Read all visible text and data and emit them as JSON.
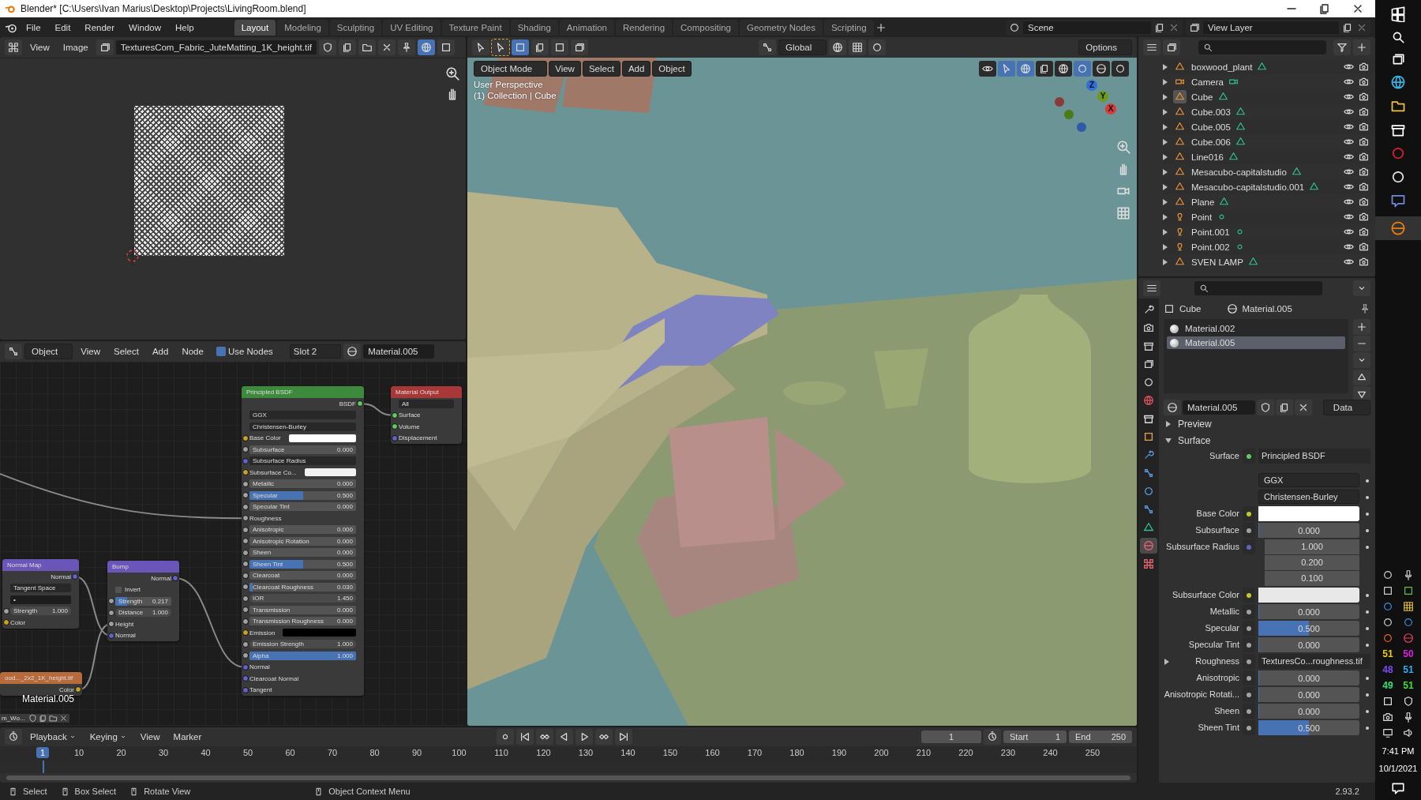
{
  "window": {
    "title": "Blender* [C:\\Users\\Ivan Marius\\Desktop\\Projects\\LivingRoom.blend]"
  },
  "menu": [
    "File",
    "Edit",
    "Render",
    "Window",
    "Help"
  ],
  "workspaces": [
    {
      "label": "Layout",
      "selected": true
    },
    {
      "label": "Modeling",
      "selected": false
    },
    {
      "label": "Sculpting",
      "selected": false
    },
    {
      "label": "UV Editing",
      "selected": false
    },
    {
      "label": "Texture Paint",
      "selected": false
    },
    {
      "label": "Shading",
      "selected": false
    },
    {
      "label": "Animation",
      "selected": false
    },
    {
      "label": "Rendering",
      "selected": false
    },
    {
      "label": "Compositing",
      "selected": false
    },
    {
      "label": "Geometry Nodes",
      "selected": false
    },
    {
      "label": "Scripting",
      "selected": false
    }
  ],
  "scene": "Scene",
  "view_layer": "View Layer",
  "image_editor": {
    "menus": [
      "View",
      "Image"
    ],
    "image": "TexturesCom_Fabric_JuteMatting_1K_height.tif"
  },
  "viewport": {
    "orientation": "Global",
    "options": "Options",
    "mode": "Object Mode",
    "menus": [
      "View",
      "Select",
      "Add",
      "Object"
    ],
    "overlay": [
      "User Perspective",
      "(1) Collection | Cube"
    ],
    "gizmo": [
      {
        "label": "Z",
        "color": "#2f6fd8"
      },
      {
        "label": "Y",
        "color": "#6a9a1e"
      },
      {
        "label": "X",
        "color": "#d83a3a"
      }
    ]
  },
  "node_editor": {
    "object": "Object",
    "menus": [
      "View",
      "Select",
      "Add",
      "Node"
    ],
    "use_nodes": {
      "label": "Use Nodes",
      "checked": true
    },
    "slot": "Slot 2",
    "material": "Material.005",
    "material_label": "Material.005",
    "image_footer": "m_Wo...",
    "nodes": [
      {
        "title": "Principled BSDF",
        "kind": "shader",
        "rows": [
          {
            "kind": "output",
            "label": "BSDF",
            "socket": {
              "color": "#63c763"
            }
          },
          {
            "kind": "dropdown",
            "value": "GGX"
          },
          {
            "kind": "dropdown",
            "value": "Christensen-Burley"
          },
          {
            "kind": "color",
            "label": "Base Color",
            "socket": {
              "color": "#c7a229"
            },
            "color": "#ffffff"
          },
          {
            "kind": "slider",
            "label": "Subsurface",
            "value": "0.000",
            "level": 0,
            "socket": {
              "color": "#a1a1a1"
            }
          },
          {
            "kind": "dropdown",
            "value": "Subsurface Radius",
            "socket": {
              "color": "#6363c7"
            }
          },
          {
            "kind": "color",
            "label": "Subsurface Co...",
            "socket": {
              "color": "#c7a229"
            },
            "color": "#f2f2f2"
          },
          {
            "kind": "slider",
            "label": "Metallic",
            "value": "0.000",
            "level": 0,
            "socket": {
              "color": "#a1a1a1"
            }
          },
          {
            "kind": "slider",
            "label": "Specular",
            "value": "0.500",
            "level": 0.5,
            "socket": {
              "color": "#a1a1a1"
            }
          },
          {
            "kind": "slider",
            "label": "Specular Tint",
            "value": "0.000",
            "level": 0,
            "socket": {
              "color": "#a1a1a1"
            }
          },
          {
            "kind": "input",
            "label": "Roughness",
            "socket": {
              "color": "#a1a1a1"
            }
          },
          {
            "kind": "slider",
            "label": "Anisotropic",
            "value": "0.000",
            "level": 0,
            "socket": {
              "color": "#a1a1a1"
            }
          },
          {
            "kind": "slider",
            "label": "Anisotropic Rotation",
            "value": "0.000",
            "level": 0,
            "socket": {
              "color": "#a1a1a1"
            }
          },
          {
            "kind": "slider",
            "label": "Sheen",
            "value": "0.000",
            "level": 0,
            "socket": {
              "color": "#a1a1a1"
            }
          },
          {
            "kind": "slider",
            "label": "Sheen Tint",
            "value": "0.500",
            "level": 0.5,
            "socket": {
              "color": "#a1a1a1"
            }
          },
          {
            "kind": "slider",
            "label": "Clearcoat",
            "value": "0.000",
            "level": 0,
            "socket": {
              "color": "#a1a1a1"
            }
          },
          {
            "kind": "slider",
            "label": "Clearcoat Roughness",
            "value": "0.030",
            "level": 0.03,
            "socket": {
              "color": "#a1a1a1"
            }
          },
          {
            "kind": "number",
            "label": "IOR",
            "value": "1.450",
            "socket": {
              "color": "#a1a1a1"
            }
          },
          {
            "kind": "slider",
            "label": "Transmission",
            "value": "0.000",
            "level": 0,
            "socket": {
              "color": "#a1a1a1"
            }
          },
          {
            "kind": "slider",
            "label": "Transmission Roughness",
            "value": "0.000",
            "level": 0,
            "socket": {
              "color": "#a1a1a1"
            }
          },
          {
            "kind": "color",
            "label": "Emission",
            "socket": {
              "color": "#c7a229"
            },
            "color": "#000000"
          },
          {
            "kind": "number",
            "label": "Emission Strength",
            "value": "1.000",
            "socket": {
              "color": "#a1a1a1"
            }
          },
          {
            "kind": "slider",
            "label": "Alpha",
            "value": "1.000",
            "level": 1,
            "socket": {
              "color": "#a1a1a1"
            }
          },
          {
            "kind": "input",
            "label": "Normal",
            "socket": {
              "color": "#6363c7"
            }
          },
          {
            "kind": "input",
            "label": "Clearcoat Normal",
            "socket": {
              "color": "#6363c7"
            }
          },
          {
            "kind": "input",
            "label": "Tangent",
            "socket": {
              "color": "#6363c7"
            }
          }
        ]
      },
      {
        "title": "Material Output",
        "kind": "output",
        "rows": [
          {
            "kind": "dropdown",
            "value": "All"
          },
          {
            "kind": "input",
            "label": "Surface",
            "socket": {
              "color": "#63c763"
            }
          },
          {
            "kind": "input",
            "label": "Volume",
            "socket": {
              "color": "#63c763"
            }
          },
          {
            "kind": "input",
            "label": "Displacement",
            "socket": {
              "color": "#6363c7"
            }
          }
        ]
      },
      {
        "title": "Normal Map",
        "kind": "vector",
        "rows": [
          {
            "kind": "output",
            "label": "Normal",
            "socket": {
              "color": "#6363c7"
            }
          },
          {
            "kind": "dropdown",
            "value": "Tangent Space"
          },
          {
            "kind": "field",
            "value": "•"
          },
          {
            "kind": "number",
            "label": "Strength",
            "value": "1.000",
            "socket": {
              "color": "#a1a1a1"
            }
          },
          {
            "kind": "input",
            "label": "Color",
            "socket": {
              "color": "#c7a229"
            }
          }
        ]
      },
      {
        "title": "Bump",
        "kind": "vector",
        "rows": [
          {
            "kind": "output",
            "label": "Normal",
            "socket": {
              "color": "#6363c7"
            }
          },
          {
            "kind": "checkbox",
            "label": "Invert",
            "checked": false
          },
          {
            "kind": "slider",
            "label": "Strength",
            "value": "0.217",
            "level": 0.217,
            "socket": {
              "color": "#a1a1a1"
            }
          },
          {
            "kind": "number",
            "label": "Distance",
            "value": "1.000",
            "socket": {
              "color": "#a1a1a1"
            }
          },
          {
            "kind": "input",
            "label": "Height",
            "socket": {
              "color": "#a1a1a1"
            }
          },
          {
            "kind": "input",
            "label": "Normal",
            "socket": {
              "color": "#6363c7"
            }
          }
        ]
      },
      {
        "title": "ood..._2x2_1K_height.tif",
        "kind": "texture",
        "rows": [
          {
            "kind": "output",
            "label": "Color",
            "socket": {
              "color": "#c7a229"
            }
          }
        ]
      }
    ]
  },
  "outliner": {
    "items": [
      {
        "name": "boxwood_plant",
        "kind": "mesh",
        "active": false
      },
      {
        "name": "Camera",
        "kind": "camera",
        "active": false
      },
      {
        "name": "Cube",
        "kind": "mesh",
        "active": true
      },
      {
        "name": "Cube.003",
        "kind": "mesh",
        "active": false
      },
      {
        "name": "Cube.005",
        "kind": "mesh",
        "active": false
      },
      {
        "name": "Cube.006",
        "kind": "mesh",
        "active": false
      },
      {
        "name": "Line016",
        "kind": "mesh",
        "active": false
      },
      {
        "name": "Mesacubo-capitalstudio",
        "kind": "mesh",
        "active": false
      },
      {
        "name": "Mesacubo-capitalstudio.001",
        "kind": "mesh",
        "active": false
      },
      {
        "name": "Plane",
        "kind": "mesh",
        "active": false
      },
      {
        "name": "Point",
        "kind": "light",
        "active": false
      },
      {
        "name": "Point.001",
        "kind": "light",
        "active": false
      },
      {
        "name": "Point.002",
        "kind": "light",
        "active": false
      },
      {
        "name": "SVEN LAMP",
        "kind": "mesh",
        "active": false
      }
    ]
  },
  "properties": {
    "tabs": [
      {
        "kind": "tool",
        "selected": false
      },
      {
        "kind": "render",
        "selected": false
      },
      {
        "kind": "output",
        "selected": false
      },
      {
        "kind": "view_layer",
        "selected": false
      },
      {
        "kind": "scene",
        "selected": false
      },
      {
        "kind": "world",
        "selected": false
      },
      {
        "kind": "collection",
        "selected": false
      },
      {
        "kind": "object",
        "selected": false
      },
      {
        "kind": "modifier",
        "selected": false
      },
      {
        "kind": "particles",
        "selected": false
      },
      {
        "kind": "physics",
        "selected": false
      },
      {
        "kind": "constraints",
        "selected": false
      },
      {
        "kind": "data",
        "selected": false
      },
      {
        "kind": "material",
        "selected": true
      },
      {
        "kind": "texture",
        "selected": false
      }
    ],
    "object": "Cube",
    "material": "Material.005",
    "slots": [
      {
        "name": "Material.002",
        "selected": false
      },
      {
        "name": "Material.005",
        "selected": true
      }
    ],
    "datablock": "Material.005",
    "link": "Data",
    "panels": [
      {
        "title": "Preview",
        "expanded": false
      },
      {
        "title": "Surface",
        "expanded": true
      }
    ],
    "rows": [
      {
        "kind": "shader",
        "label": "Surface",
        "value": "Principled BSDF"
      },
      {
        "kind": "dropdown",
        "value": "GGX"
      },
      {
        "kind": "dropdown",
        "value": "Christensen-Burley"
      },
      {
        "kind": "color",
        "label": "Base Color",
        "color": "#ffffff"
      },
      {
        "kind": "slider",
        "label": "Subsurface",
        "value": "0.000",
        "level": 0
      },
      {
        "kind": "vector",
        "label": "Subsurface Radius",
        "values": [
          "1.000",
          "0.200",
          "0.100"
        ]
      },
      {
        "kind": "color",
        "label": "Subsurface Color",
        "color": "#e8e8e8"
      },
      {
        "kind": "slider",
        "label": "Metallic",
        "value": "0.000",
        "level": 0
      },
      {
        "kind": "slider",
        "label": "Specular",
        "value": "0.500",
        "level": 0.5
      },
      {
        "kind": "slider",
        "label": "Specular Tint",
        "value": "0.000",
        "level": 0
      },
      {
        "kind": "link",
        "label": "Roughness",
        "value": "TexturesCo...roughness.tif"
      },
      {
        "kind": "slider",
        "label": "Anisotropic",
        "value": "0.000",
        "level": 0
      },
      {
        "kind": "slider",
        "label": "Anisotropic Rotati...",
        "value": "0.000",
        "level": 0
      },
      {
        "kind": "slider",
        "label": "Sheen",
        "value": "0.000",
        "level": 0
      },
      {
        "kind": "slider",
        "label": "Sheen Tint",
        "value": "0.500",
        "level": 0.5
      }
    ]
  },
  "timeline": {
    "menus": [
      "Playback",
      "Keying",
      "View",
      "Marker"
    ],
    "frame": "1",
    "start_label": "Start",
    "start": "1",
    "end_label": "End",
    "end": "250",
    "playhead": "1",
    "ruler": [
      "10",
      "20",
      "30",
      "40",
      "50",
      "60",
      "70",
      "80",
      "90",
      "100",
      "110",
      "120",
      "130",
      "140",
      "150",
      "160",
      "170",
      "180",
      "190",
      "200",
      "210",
      "220",
      "230",
      "240",
      "250"
    ]
  },
  "status_bar": {
    "items": [
      "Select",
      "Box Select",
      "Rotate View",
      "Object Context Menu"
    ],
    "version": "2.93.2"
  },
  "taskbar": {
    "counters": [
      {
        "text": "51",
        "color": "#f0d000"
      },
      {
        "text": "50",
        "color": "#e020e0"
      },
      {
        "text": "48",
        "color": "#7a4cf0"
      },
      {
        "text": "51",
        "color": "#30b0f0"
      },
      {
        "text": "49",
        "color": "#30e070"
      },
      {
        "text": "51",
        "color": "#40e040"
      }
    ],
    "time": "7:41 PM",
    "date": "10/1/2021"
  }
}
